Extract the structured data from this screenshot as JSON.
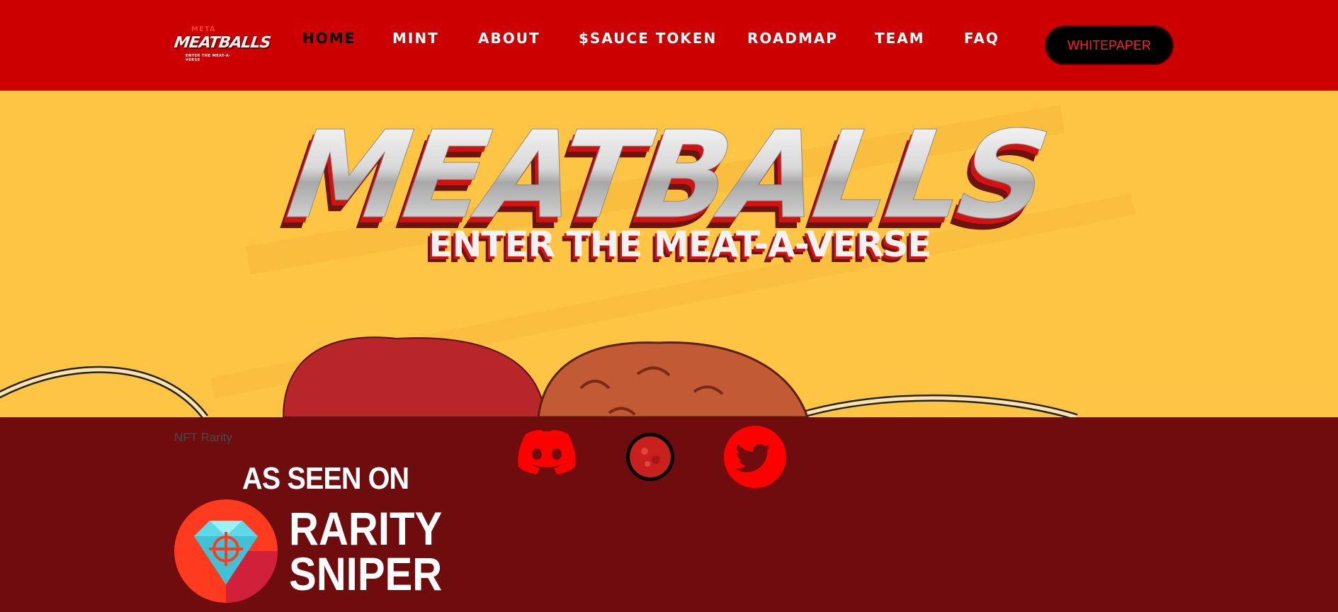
{
  "logo": {
    "line1": "META",
    "line2": "MEATBALLS",
    "line3": "ENTER THE MEAT-A-VERSE"
  },
  "nav": {
    "items": [
      {
        "label": "HOME",
        "active": true
      },
      {
        "label": "MINT",
        "active": false
      },
      {
        "label": "ABOUT",
        "active": false
      },
      {
        "label": "$SAUCE TOKEN",
        "active": false
      },
      {
        "label": "ROADMAP",
        "active": false
      },
      {
        "label": "TEAM",
        "active": false
      },
      {
        "label": "FAQ",
        "active": false
      }
    ],
    "whitepaper_label": "WHITEPAPER"
  },
  "hero": {
    "title": "MEATBALLS",
    "subtitle": "ENTER THE MEAT-A-VERSE"
  },
  "footer": {
    "nft_rarity_label": "NFT Rarity",
    "social": [
      {
        "name": "discord-icon"
      },
      {
        "name": "opensea-icon"
      },
      {
        "name": "twitter-icon"
      }
    ],
    "as_seen_on": "AS SEEN ON",
    "rarity_sniper_line1": "RARITY",
    "rarity_sniper_line2": "SNIPER"
  },
  "colors": {
    "header_bg": "#cc0000",
    "hero_bg": "#fec444",
    "footer_bg": "#6e0c0e",
    "nav_text": "#ffffff",
    "nav_active": "#000000",
    "button_bg": "#000000",
    "button_text": "#ff1f1f",
    "social_red": "#ff0000"
  }
}
